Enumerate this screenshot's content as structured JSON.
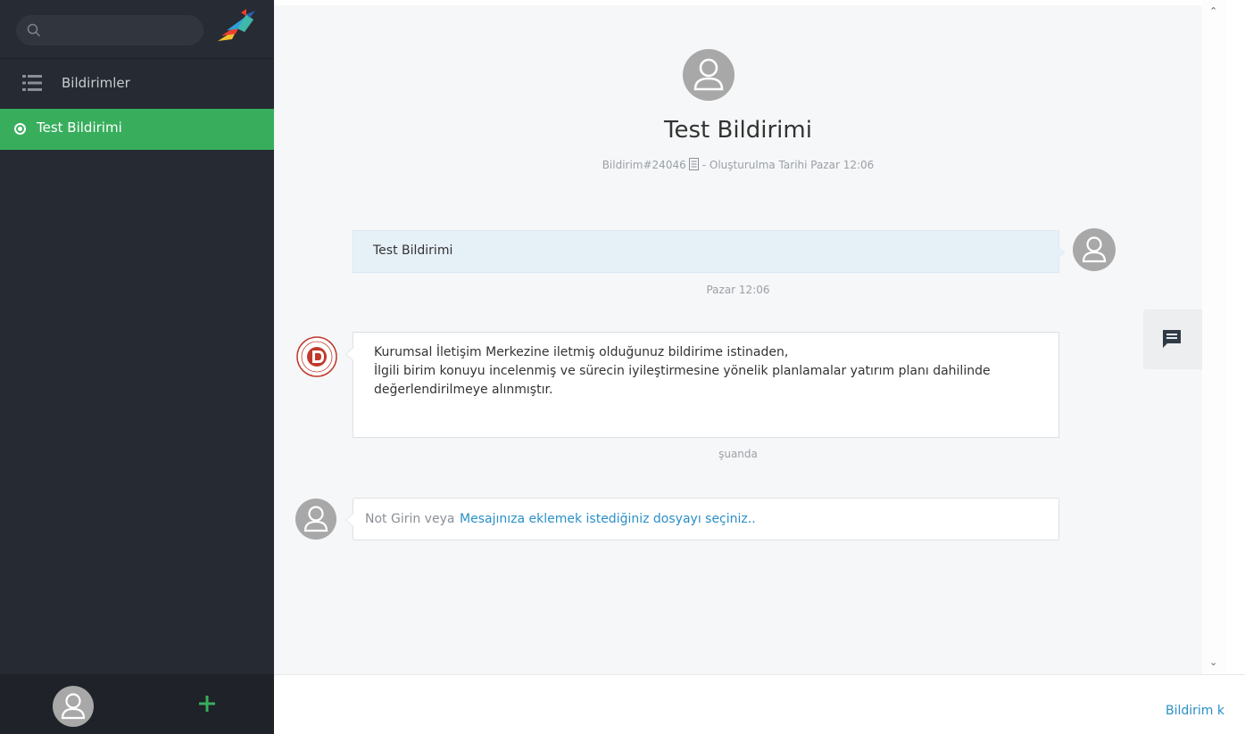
{
  "sidebar": {
    "search": {
      "placeholder": ""
    },
    "nav": {
      "bildirimler_label": "Bildirimler"
    },
    "items": [
      {
        "label": "Test Bildirimi",
        "active": true
      }
    ]
  },
  "ticket": {
    "title": "Test Bildirimi",
    "number": "Bildirim#24046",
    "meta_suffix": "- Oluşturulma Tarihi Pazar 12:06"
  },
  "messages": [
    {
      "sender": "user",
      "text": "Test Bildirimi",
      "time": "Pazar 12:06"
    },
    {
      "sender": "agent",
      "lines": [
        "Kurumsal İletişim Merkezine iletmiş olduğunuz bildirime istinaden,",
        "İlgili birim konuyu incelenmiş ve sürecin iyileştirmesine yönelik planlamalar yatırım planı dahilinde",
        "değerlendirilmeye alınmıştır."
      ],
      "time": "şuanda"
    }
  ],
  "compose": {
    "placeholder": "Not Girin veya",
    "attach_link": "Mesajınıza eklemek istediğiniz dosyayı seçiniz.."
  },
  "footer": {
    "link": "Bildirim k"
  },
  "colors": {
    "accent": "#38ae5d",
    "sidebar": "#262a32",
    "link": "#2a8fc7"
  },
  "icons": [
    "search-icon",
    "logo-bird-icon",
    "list-icon",
    "radio-icon",
    "avatar-icon",
    "plus-icon",
    "document-icon",
    "chat-icon",
    "university-seal-icon",
    "chevron-up-icon",
    "chevron-down-icon"
  ]
}
